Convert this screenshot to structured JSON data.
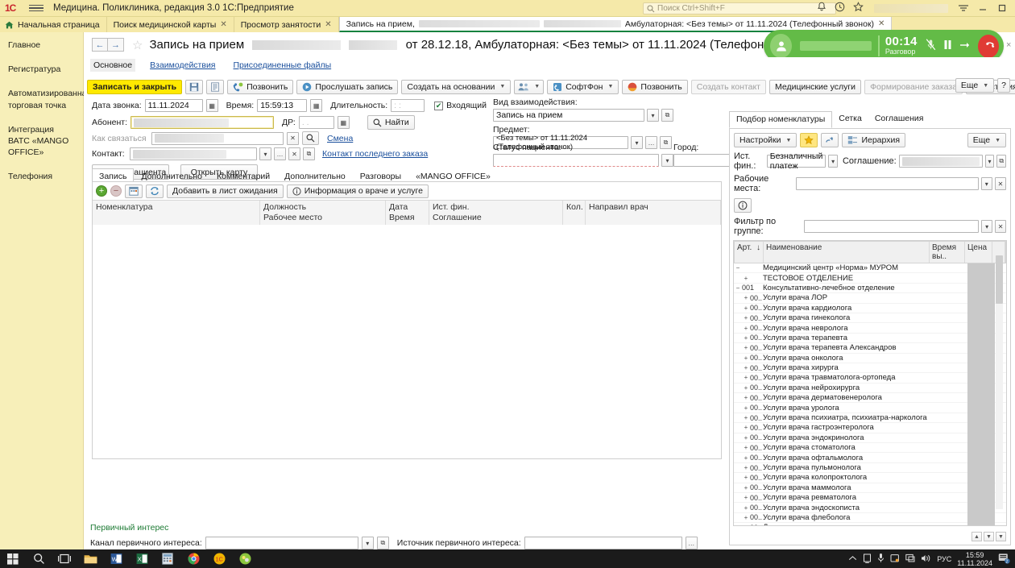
{
  "titlebar": {
    "logo": "1C",
    "app_title": "Медицина. Поликлиника, редакция 3.0 1С:Предприятие",
    "search_placeholder": "Поиск Ctrl+Shift+F",
    "icons": [
      "bell-icon",
      "history-icon",
      "star-icon",
      "menu-icon"
    ],
    "window_buttons": [
      "minimize",
      "maximize",
      "close"
    ]
  },
  "tabs": [
    {
      "label": "Начальная страница",
      "closable": false,
      "active": false,
      "icon": "home-icon"
    },
    {
      "label": "Поиск медицинской карты",
      "closable": true,
      "active": false
    },
    {
      "label": "Просмотр занятости",
      "closable": true,
      "active": false
    },
    {
      "label": "Запись на прием,",
      "label2": "Амбулаторная: <Без темы> от 11.11.2024 (Телефонный звонок)",
      "closable": true,
      "active": true
    }
  ],
  "sidebar": {
    "items": [
      {
        "label": "Главное"
      },
      {
        "label": "Регистратура"
      },
      {
        "label": "Автоматизированная торговая точка"
      },
      {
        "label": "Интеграция ВАТС «MANGO OFFICE»"
      },
      {
        "label": "Телефония"
      }
    ]
  },
  "document": {
    "title_prefix": "Запись на прием",
    "title_suffix": "от 28.12.18, Амбулаторная: <Без темы> от 11.11.2024 (Телефонный звонок)",
    "back_arrow": "←",
    "forward_arrow": "→",
    "favorite_icon": "star-icon"
  },
  "call": {
    "timer": "00:14",
    "status": "Разговор",
    "mute_icon": "mic-off-icon",
    "pause_icon": "pause-icon",
    "transfer_icon": "transfer-icon",
    "hangup_icon": "phone-hangup-icon",
    "accent_green": "#63bb47",
    "accent_red": "#e03b34",
    "close": "×"
  },
  "subtabs": [
    {
      "label": "Основное",
      "selected": true
    },
    {
      "label": "Взаимодействия",
      "link": true
    },
    {
      "label": "Присоединенные файлы",
      "link": true
    }
  ],
  "toolbar": {
    "save_and_close": "Записать и закрыть",
    "save_icon": "floppy-icon",
    "print_icon": "list-icon",
    "call_button": "Позвонить",
    "listen_record": "Прослушать запись",
    "create_based_on": "Создать на основании",
    "contacts_icon": "people-icon",
    "softphone": "СофтФон",
    "call_button2": "Позвонить",
    "create_contact": "Создать контакт",
    "medical_services": "Медицинские услуги",
    "form_order": "Формирование заказа",
    "record_history": "История записи",
    "more": "Еще",
    "help": "?"
  },
  "form": {
    "call_date_label": "Дата звонка:",
    "call_date_value": "11.11.2024",
    "time_label": "Время:",
    "time_value": "15:59:13",
    "duration_label": "Длительность:",
    "duration_value": " :  :",
    "incoming_label": "Входящий",
    "incoming_checked": true,
    "subscriber_label": "Абонент:",
    "subscriber_value": "",
    "dr_label": "ДР:",
    "dr_value": "  .  .",
    "find_button": "Найти",
    "how_to_contact_label": "Как связаться",
    "change_link": "Смена",
    "contact_label": "Контакт:",
    "last_order_contact_link": "Контакт последнего заказа",
    "create_patient_button": "Создать пациента",
    "open_card_button": "Открыть карту",
    "interaction_kind_label": "Вид взаимодействия:",
    "interaction_kind_value": "Запись на прием",
    "subject_label": "Предмет:",
    "subject_value": "<Без темы> от 11.11.2024 (Телефонный звонок)",
    "patient_status_label": "Статус пациента:",
    "patient_status_value": "",
    "city_label": "Город:",
    "city_value": ""
  },
  "record_tabs": [
    {
      "label": "Запись",
      "selected": true
    },
    {
      "label": "Дополнительно",
      "selected": false
    },
    {
      "label": "Комментарий",
      "selected": false
    },
    {
      "label": "Дополнительно",
      "selected": false
    },
    {
      "label": "Разговоры",
      "selected": false
    },
    {
      "label": "«MANGO OFFICE»",
      "selected": false
    }
  ],
  "record_grid": {
    "tools": {
      "add_icon": "plus-circle-icon",
      "delete_icon": "minus-circle-icon",
      "book_icon": "calendar-icon",
      "refresh_icon": "refresh-icon",
      "add_to_waitlist": "Добавить в лист ожидания",
      "doctor_info": "Информация о враче и услуге",
      "info_icon": "info-icon"
    },
    "columns": [
      {
        "top": "Номенклатура",
        "bottom": ""
      },
      {
        "top": "Должность",
        "bottom": "Рабочее место"
      },
      {
        "top": "Дата",
        "bottom": "Время"
      },
      {
        "top": "Ист. фин.",
        "bottom": "Соглашение"
      },
      {
        "top": "Кол.",
        "bottom": ""
      },
      {
        "top": "Направил врач",
        "bottom": ""
      }
    ],
    "rows": []
  },
  "primary_interest": {
    "title": "Первичный интерес",
    "channel_label": "Канал первичного интереса:",
    "channel_value": "",
    "source_label": "Источник первичного интереса:",
    "source_value": ""
  },
  "right_panel": {
    "tabs": [
      {
        "label": "Подбор номенклатуры",
        "selected": true
      },
      {
        "label": "Сетка",
        "selected": false
      },
      {
        "label": "Соглашения",
        "selected": false
      }
    ],
    "toolbar": {
      "settings": "Настройки",
      "favorite_icon": "star-icon",
      "link_icon": "link-icon",
      "hierarchy": "Иерархия",
      "hierarchy_icon": "hierarchy-icon",
      "more": "Еще"
    },
    "fields": {
      "fin_source_label": "Ист. фин.:",
      "fin_source_value": "Безналичный платеж",
      "agreement_label": "Соглашение:",
      "agreement_value": "",
      "workplaces_label": "Рабочие места:",
      "workplaces_value": "",
      "info_icon": "info-circle-icon",
      "group_filter_label": "Фильтр по группе:",
      "group_filter_value": ""
    },
    "tree_columns": [
      {
        "label": "Арт.",
        "sort": "↓"
      },
      {
        "label": "Наименование"
      },
      {
        "label": "Время вы.."
      },
      {
        "label": "Цена"
      }
    ],
    "tree_rows": [
      {
        "indent": 0,
        "expander": "−",
        "art": "",
        "name": "Медицинский центр «Норма» МУРОМ"
      },
      {
        "indent": 1,
        "expander": "+",
        "art": "",
        "name": "ТЕСТОВОЕ ОТДЕЛЕНИЕ"
      },
      {
        "indent": 0,
        "expander": "−",
        "art": "001",
        "name": "Консультативно-лечебное отделение"
      },
      {
        "indent": 1,
        "expander": "+",
        "art": "00..",
        "name": "Услуги врача ЛОР"
      },
      {
        "indent": 1,
        "expander": "+",
        "art": "00..",
        "name": "Услуги врача кардиолога"
      },
      {
        "indent": 1,
        "expander": "+",
        "art": "00..",
        "name": "Услуги врача гинеколога"
      },
      {
        "indent": 1,
        "expander": "+",
        "art": "00..",
        "name": "Услуги врача невролога"
      },
      {
        "indent": 1,
        "expander": "+",
        "art": "00..",
        "name": "Услуги врача терапевта"
      },
      {
        "indent": 1,
        "expander": "+",
        "art": "00..",
        "name": "Услуги врача терапевта Александров"
      },
      {
        "indent": 1,
        "expander": "+",
        "art": "00..",
        "name": "Услуги врача онколога"
      },
      {
        "indent": 1,
        "expander": "+",
        "art": "00..",
        "name": "Услуги врача хирурга"
      },
      {
        "indent": 1,
        "expander": "+",
        "art": "00..",
        "name": "Услуги врача травматолога-ортопеда"
      },
      {
        "indent": 1,
        "expander": "+",
        "art": "00..",
        "name": "Услуги врача нейрохирурга"
      },
      {
        "indent": 1,
        "expander": "+",
        "art": "00..",
        "name": "Услуги врача дерматовенеролога"
      },
      {
        "indent": 1,
        "expander": "+",
        "art": "00..",
        "name": "Услуги врача уролога"
      },
      {
        "indent": 1,
        "expander": "+",
        "art": "00..",
        "name": "Услуги врача психиатра, психиатра-нарколога"
      },
      {
        "indent": 1,
        "expander": "+",
        "art": "00..",
        "name": "Услуги врача гастроэнтеролога"
      },
      {
        "indent": 1,
        "expander": "+",
        "art": "00..",
        "name": "Услуги врача эндокринолога"
      },
      {
        "indent": 1,
        "expander": "+",
        "art": "00..",
        "name": "Услуги врача стоматолога"
      },
      {
        "indent": 1,
        "expander": "+",
        "art": "00..",
        "name": "Услуги врача офтальмолога"
      },
      {
        "indent": 1,
        "expander": "+",
        "art": "00..",
        "name": "Услуги врача пульмонолога"
      },
      {
        "indent": 1,
        "expander": "+",
        "art": "00..",
        "name": "Услуги врача колопроктолога"
      },
      {
        "indent": 1,
        "expander": "+",
        "art": "00..",
        "name": "Услуги врача маммолога"
      },
      {
        "indent": 1,
        "expander": "+",
        "art": "00..",
        "name": "Услуги врача ревматолога"
      },
      {
        "indent": 1,
        "expander": "+",
        "art": "00..",
        "name": "Услуги врача эндоскописта"
      },
      {
        "indent": 1,
        "expander": "+",
        "art": "00..",
        "name": "Услуги врача флеболога"
      },
      {
        "indent": 1,
        "expander": "+",
        "art": "00..",
        "name": "Детское отделение"
      }
    ]
  },
  "taskbar": {
    "items": [
      "start-icon",
      "search-icon",
      "taskview-icon",
      "explorer-icon",
      "word-icon",
      "excel-icon",
      "calculator-icon",
      "chrome-icon",
      "1c-icon",
      "app-icon"
    ],
    "tray_icons": [
      "chevron-up-icon",
      "display-icon",
      "mic-icon",
      "shield-icon",
      "monitor-icon",
      "volume-icon"
    ],
    "language": "РУС",
    "clock_time": "15:59",
    "clock_date": "11.11.2024",
    "notification_count": "2"
  }
}
